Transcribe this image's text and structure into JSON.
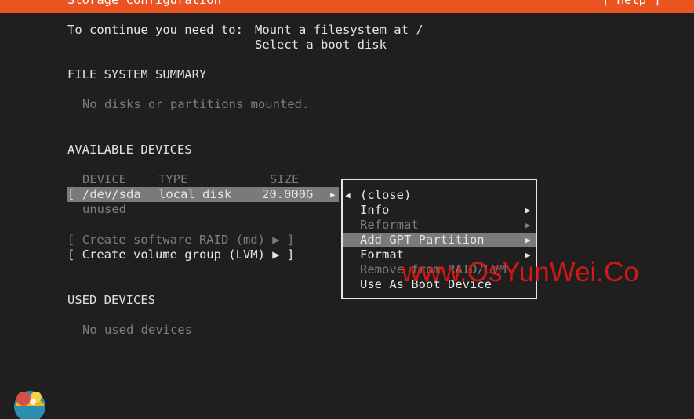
{
  "header": {
    "title": "Storage configuration",
    "help": "[ Help ]"
  },
  "instructions": {
    "prefix": "To continue you need to:",
    "line1": "Mount a filesystem at /",
    "line2": "Select a boot disk"
  },
  "fs_summary": {
    "heading": "FILE SYSTEM SUMMARY",
    "empty": "No disks or partitions mounted."
  },
  "available": {
    "heading": "AVAILABLE DEVICES",
    "columns": [
      "DEVICE",
      "TYPE",
      "SIZE"
    ],
    "device": {
      "bracket": "[",
      "name": "/dev/sda",
      "type": "local disk",
      "size": "20.000G",
      "arrow": "▶",
      "status": "unused"
    },
    "raid": "[ Create software RAID (md) ▶ ]",
    "lvm": "[ Create volume group (LVM) ▶ ]"
  },
  "used": {
    "heading": "USED DEVICES",
    "empty": "No used devices"
  },
  "menu": {
    "close": {
      "arrow": "◀",
      "label": "(close)"
    },
    "items": [
      {
        "label": "Info",
        "arrow": "▶"
      },
      {
        "label": "Reformat",
        "arrow": "▶"
      },
      {
        "label": "Add GPT Partition",
        "arrow": "▶"
      },
      {
        "label": "Format",
        "arrow": "▶"
      },
      {
        "label": "Remove from RAID/LVM",
        "arrow": ""
      },
      {
        "label": "Use As Boot Device",
        "arrow": ""
      }
    ]
  },
  "watermark": "www.OsYunWei.Co",
  "colors": {
    "accent": "#e95420",
    "background": "#1f1f1f",
    "highlight": "#7a7a7a",
    "watermark": "#e01818"
  },
  "icons": {
    "logo": "ubuntu-installer-logo-icon"
  }
}
